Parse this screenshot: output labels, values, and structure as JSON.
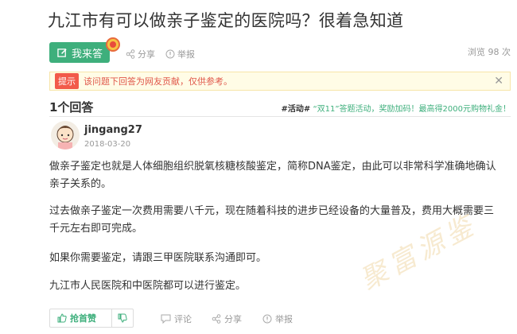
{
  "page": {
    "title": "九江市有可以做亲子鉴定的医院吗？很着急知道"
  },
  "toolbar": {
    "ask_label": "我来答",
    "share_label": "分享",
    "report_label": "举报",
    "views_text": "浏览 98 次"
  },
  "tip": {
    "tag": "提示",
    "text": "该问题下回答为网友贡献，仅供参考。"
  },
  "answers": {
    "count_label": "1个回答",
    "promo_tag": "#活动#",
    "promo_text": "“双11”答题活动，奖励加码！最高得2000元购物礼金！"
  },
  "answer": {
    "username": "jingang27",
    "date": "2018-03-20",
    "paragraphs": [
      "做亲子鉴定也就是人体细胞组织脱氧核糖核酸鉴定，简称DNA鉴定，由此可以非常科学准确地确认亲子关系的。",
      "过去做亲子鉴定一次费用需要八千元，现在随着科技的进步已经设备的大量普及，费用大概需要三千元左右即可完成。",
      "如果你需要鉴定，请跟三甲医院联系沟通即可。",
      "九江市人民医院和中医院都可以进行鉴定。"
    ],
    "watermark": "聚富源鉴"
  },
  "actions": {
    "like_label": "抢首赞",
    "comment_label": "评论",
    "share_label": "分享",
    "report_label": "举报"
  },
  "colors": {
    "accent": "#3eaf7c",
    "tip_red": "#f25a4a",
    "tip_bg": "#fffce6"
  }
}
